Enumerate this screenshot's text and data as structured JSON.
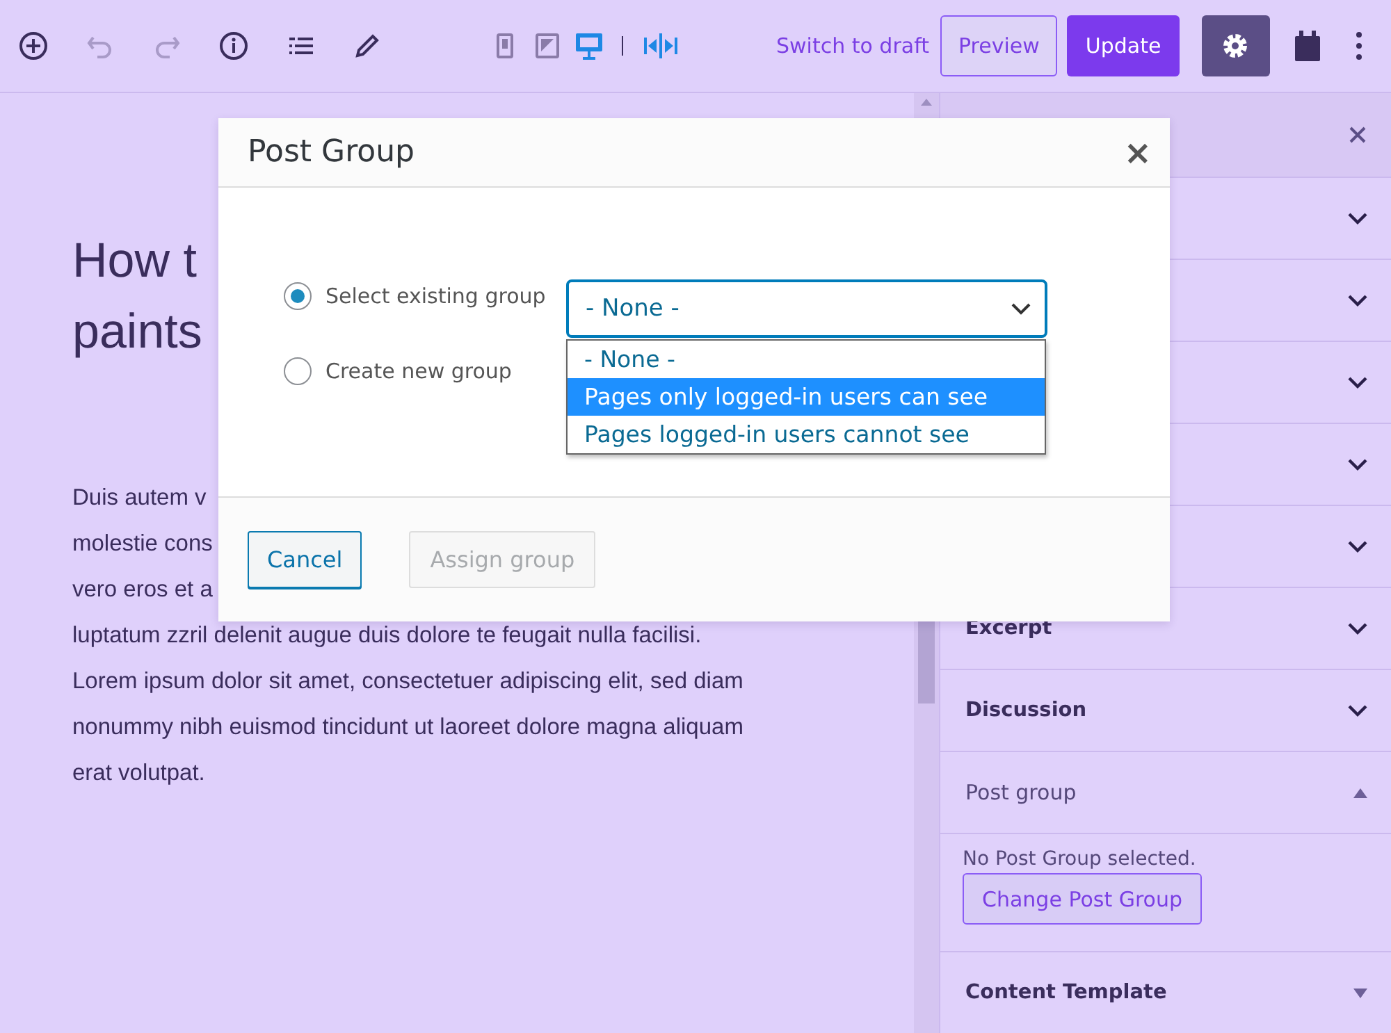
{
  "toolbar": {
    "devices": [
      {
        "selected": false
      },
      {
        "selected": false
      },
      {
        "selected": true
      }
    ],
    "switch_label": "Switch to draft",
    "preview_label": "Preview",
    "update_label": "Update",
    "settings_on": true
  },
  "editor": {
    "title_lines": [
      "How t",
      "paints"
    ],
    "paragraph_lines": [
      "Duis autem v",
      "molestie cons",
      "vero eros et a",
      "luptatum zzril delenit augue duis dolore te feugait nulla facilisi.",
      "Lorem ipsum dolor sit amet, consectetuer adipiscing elit, sed diam",
      "nonummy nibh euismod tincidunt ut laoreet dolore magna aliquam",
      "erat volutpat."
    ]
  },
  "sidebar": {
    "panels": [
      {
        "kind": "chevron",
        "expanded": false
      },
      {
        "kind": "chevron",
        "expanded": false
      },
      {
        "kind": "chevron",
        "expanded": false
      },
      {
        "kind": "chevron",
        "expanded": false
      },
      {
        "kind": "chevron",
        "expanded": false
      },
      {
        "kind": "chevron",
        "title": "Excerpt",
        "expanded": false
      },
      {
        "kind": "chevron",
        "title": "Discussion",
        "expanded": false
      },
      {
        "kind": "triangle",
        "title": "Post group",
        "expanded": true,
        "text": "No Post Group selected.",
        "button": "Change Post Group"
      },
      {
        "kind": "triangle",
        "title": "Content Template",
        "expanded": false
      }
    ]
  },
  "modal": {
    "title": "Post Group",
    "close": "×",
    "radios": [
      {
        "label": "Select existing group",
        "selected": true
      },
      {
        "label": "Create new group",
        "selected": false
      }
    ],
    "select_value": "- None -",
    "options": [
      {
        "label": "- None -",
        "selected": false
      },
      {
        "label": "Pages only logged-in users can see",
        "selected": true
      },
      {
        "label": "Pages logged-in users cannot see",
        "selected": false
      }
    ],
    "cancel": "Cancel",
    "assign": {
      "label": "Assign group",
      "disabled": true
    }
  }
}
